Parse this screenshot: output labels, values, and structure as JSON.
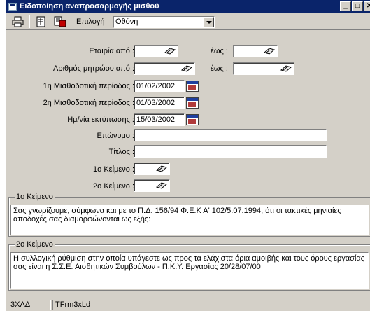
{
  "window": {
    "title": "Ειδοποίηση αναπροσαρμογής μισθού",
    "min_label": "_",
    "max_label": "□",
    "close_label": "✕"
  },
  "toolbar": {
    "selection_label": "Επιλογή",
    "output_value": "Οθόνη"
  },
  "form": {
    "company_from_label": "Εταιρία από :",
    "company_to_label": "έως :",
    "registry_from_label": "Αριθμός μητρώου από :",
    "registry_to_label": "έως :",
    "period1_label": "1η Μισθοδοτική περίοδος :",
    "period1_value": "01/02/2002",
    "period2_label": "2η Μισθοδοτική περίοδος :",
    "period2_value": "01/03/2002",
    "print_date_label": "Ημ/νία εκτύπωσης :",
    "print_date_value": "15/03/2002",
    "surname_label": "Επώνυμο :",
    "title_label": "Τίτλος :",
    "text1_label": "1ο Κείμενο :",
    "text2_label": "2ο Κείμενο :"
  },
  "text1": {
    "group_title": "1ο Κείμενο",
    "body": "  Σας γνωρίζουμε, σύμφωνα και με το Π.Δ. 156/94  Φ.Ε.Κ Α' 102/5.07.1994, ότι οι τακτικές μηνιαίες αποδοχές σας διαμορφώνονται ως εξής:"
  },
  "text2": {
    "group_title": "2ο Κείμενο",
    "body": "Η συλλογική ρύθμιση στην οποία υπάγεστε ως προς τα ελάχιστα όρια αμοιβής και τους όρους εργασίας σας είναι η Σ.Σ.Ε. Αισθητικών Συμβούλων - Π.Κ.Υ. Εργασίας 20/28/07/00"
  },
  "statusbar": {
    "panel1": "3ΧΛΔ",
    "panel2": "TFrm3xLd"
  },
  "colors": {
    "titlebar": "#0a246a",
    "face": "#d4d0c8"
  }
}
